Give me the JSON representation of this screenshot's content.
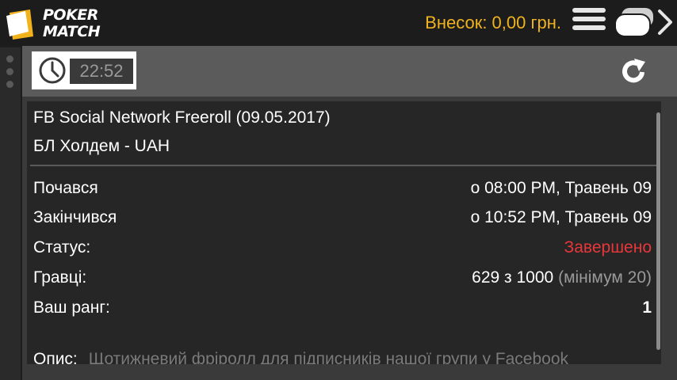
{
  "header": {
    "logo_line1": "POKER",
    "logo_line2": "MATCH",
    "balance": "Внесок: 0,00 грн.",
    "brand_color": "#f0b320",
    "menu_icon": "hamburger-icon",
    "tables_icon": "tables-switch-icon"
  },
  "panel": {
    "clock_icon": "clock-icon",
    "time": "22:52",
    "refresh_icon": "refresh-icon"
  },
  "tournament": {
    "title": "FB Social Network Freeroll (09.05.2017)",
    "game": "БЛ Холдем - UAH",
    "rows": {
      "started_label": "Почався",
      "started_value": "о 08:00 PM, Травень 09",
      "ended_label": "Закінчився",
      "ended_value": "о 10:52 PM, Травень 09",
      "status_label": "Статус:",
      "status_value": "Завершено",
      "status_color": "#e8373a",
      "players_label": "Гравці:",
      "players_value": "629 з 1000",
      "players_min": "(мінімум 20)",
      "rank_label": "Ваш ранг:",
      "rank_value": "1"
    },
    "description_label": "Опис:",
    "description_text": "Щотижневий фріролл для підписників нашої групи у Facebook"
  }
}
